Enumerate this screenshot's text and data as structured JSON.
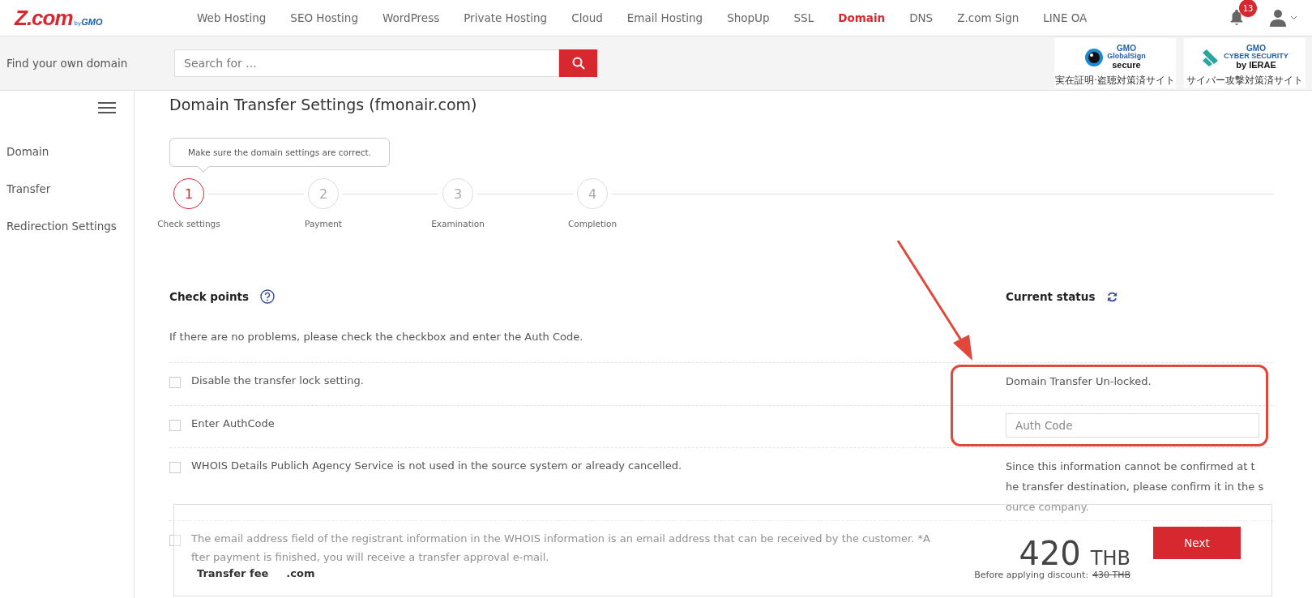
{
  "logo": {
    "main": "Z.com",
    "by": "by",
    "brand": "GMO"
  },
  "nav": [
    {
      "label": "Web Hosting",
      "selected": false
    },
    {
      "label": "SEO Hosting",
      "selected": false
    },
    {
      "label": "WordPress",
      "selected": false
    },
    {
      "label": "Private Hosting",
      "selected": false
    },
    {
      "label": "Cloud",
      "selected": false
    },
    {
      "label": "Email Hosting",
      "selected": false
    },
    {
      "label": "ShopUp",
      "selected": false
    },
    {
      "label": "SSL",
      "selected": false
    },
    {
      "label": "Domain",
      "selected": true
    },
    {
      "label": "DNS",
      "selected": false
    },
    {
      "label": "Z.com Sign",
      "selected": false
    },
    {
      "label": "LINE OA",
      "selected": false
    }
  ],
  "notifications": {
    "count": "13"
  },
  "search": {
    "label": "Find your own domain",
    "placeholder": "Search for ..."
  },
  "seals": [
    {
      "kind": "globalsign",
      "lines": [
        "GMO",
        "GlobalSign",
        "secure"
      ],
      "caption": "実在証明·盗聴対策済サイト"
    },
    {
      "kind": "ierae",
      "lines": [
        "GMO",
        "CYBER SECURITY",
        "by IERAE"
      ],
      "caption": "サイバー攻撃対策済サイト"
    }
  ],
  "sidebar": {
    "items": [
      {
        "label": "Domain"
      },
      {
        "label": "Transfer"
      },
      {
        "label": "Redirection Settings"
      }
    ]
  },
  "page_title": "Domain Transfer Settings (fmonair.com)",
  "hint": "Make sure the domain settings are correct.",
  "steps": [
    {
      "number": "1",
      "label": "Check settings",
      "selected": true
    },
    {
      "number": "2",
      "label": "Payment",
      "selected": false
    },
    {
      "number": "3",
      "label": "Examination",
      "selected": false
    },
    {
      "number": "4",
      "label": "Completion",
      "selected": false
    }
  ],
  "check_points": {
    "title": "Check points",
    "status_title": "Current status",
    "description": "If there are no problems, please check the checkbox and enter the Auth Code.",
    "rows": [
      {
        "label": "Disable the transfer lock setting.",
        "checked": false,
        "kind": "text",
        "status": [
          "Domain Transfer Un-locked."
        ]
      },
      {
        "label": "Enter AuthCode",
        "checked": false,
        "kind": "input",
        "placeholder": "Auth Code"
      },
      {
        "label": "WHOIS Details Publich Agency Service is not used in the source system or already cancelled.",
        "checked": false,
        "kind": "text",
        "status": [
          "Since this information cannot be confirmed at t",
          "he transfer destination, please confirm it in the s",
          "ource company."
        ]
      },
      {
        "label": [
          "The email address field of the registrant information in the WHOIS information is an email address that can be received by the customer. *A",
          "fter payment is finished, you will receive a transfer approval e-mail."
        ],
        "checked": false,
        "kind": "text"
      }
    ]
  },
  "footer": {
    "fee_label": "Transfer fee",
    "tld": ".com",
    "price": "420",
    "currency": "THB",
    "discount_label": "Before applying discount:",
    "original_price": "430 THB",
    "button": "Next"
  }
}
